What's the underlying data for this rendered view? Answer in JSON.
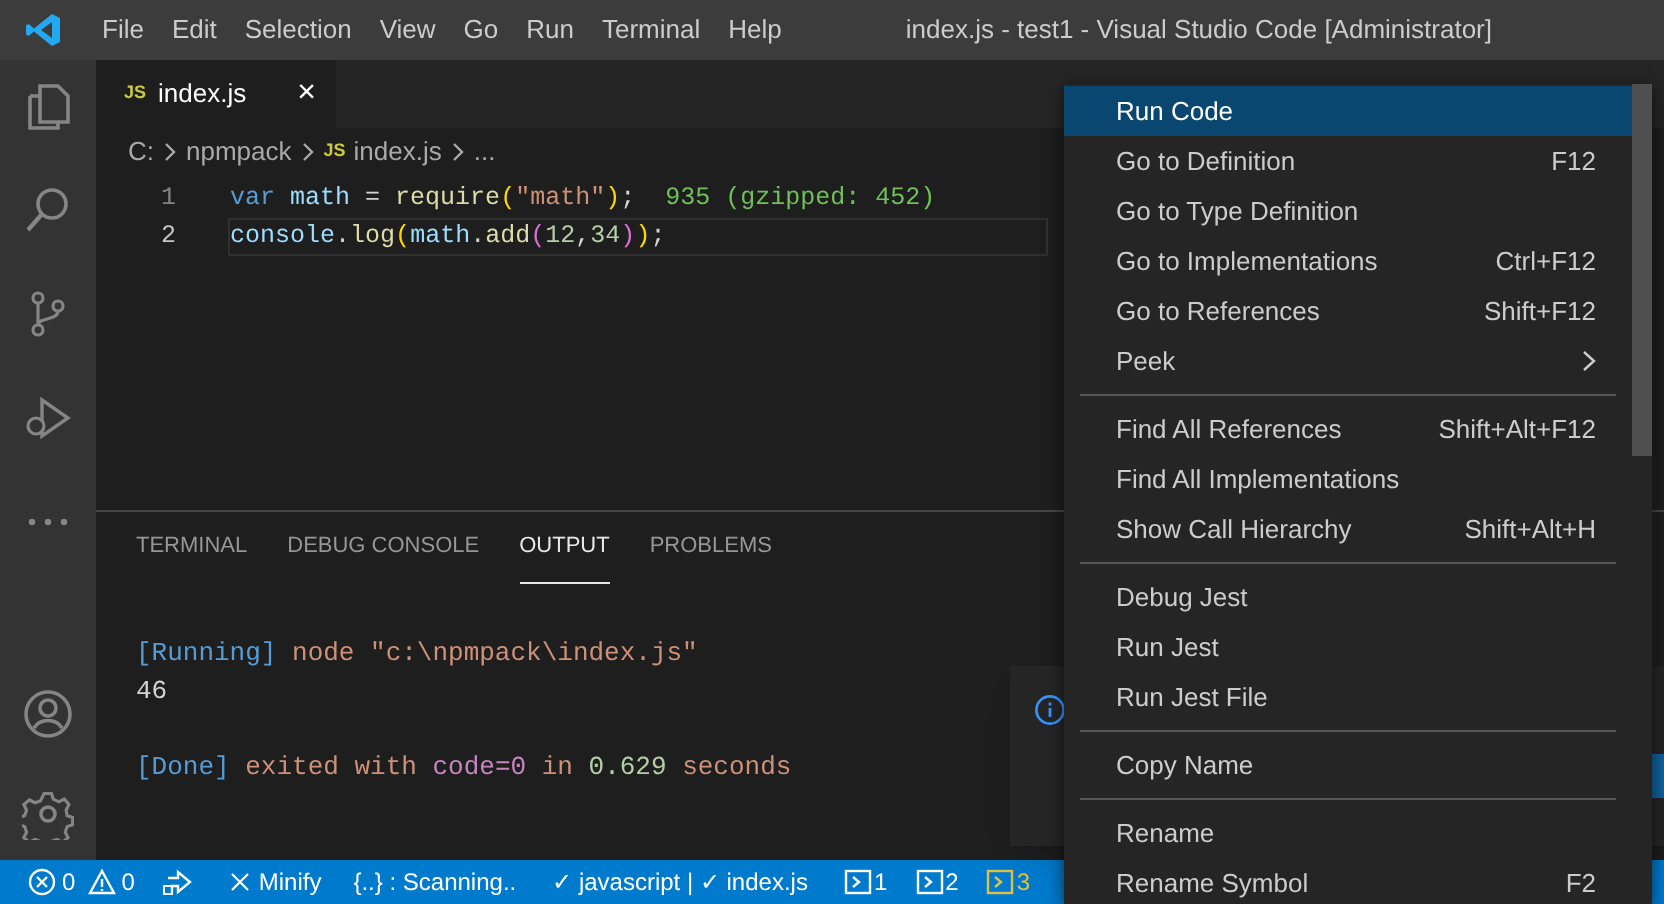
{
  "window": {
    "title": "index.js - test1 - Visual Studio Code [Administrator]"
  },
  "menu_bar": [
    "File",
    "Edit",
    "Selection",
    "View",
    "Go",
    "Run",
    "Terminal",
    "Help"
  ],
  "activity_bar": [
    {
      "kind": "files"
    },
    {
      "kind": "search"
    },
    {
      "kind": "scm"
    },
    {
      "kind": "debug"
    },
    {
      "kind": "more"
    },
    {
      "kind": "account"
    },
    {
      "kind": "settings"
    }
  ],
  "editor_tabs": [
    {
      "badge": "JS",
      "label": "index.js",
      "close": "×",
      "selected": true
    }
  ],
  "breadcrumb": [
    {
      "text": "C:"
    },
    {
      "text": "npmpack"
    },
    {
      "badge": "JS",
      "text": "index.js"
    },
    {
      "text": "..."
    }
  ],
  "code_lines": [
    {
      "number": "1",
      "current": false,
      "tokens": [
        {
          "kind": "keyword",
          "text": "var "
        },
        {
          "kind": "variable",
          "text": "math"
        },
        {
          "kind": "plain",
          "text": " = "
        },
        {
          "kind": "function",
          "text": "require"
        },
        {
          "kind": "bracket1",
          "text": "("
        },
        {
          "kind": "string",
          "text": "\"math\""
        },
        {
          "kind": "bracket1",
          "text": ")"
        },
        {
          "kind": "plain",
          "text": ";  "
        },
        {
          "kind": "hint",
          "text": "935 (gzipped: 452)"
        }
      ]
    },
    {
      "number": "2",
      "current": true,
      "tokens": [
        {
          "kind": "variable",
          "text": "console"
        },
        {
          "kind": "plain",
          "text": "."
        },
        {
          "kind": "function",
          "text": "log"
        },
        {
          "kind": "bracket1",
          "text": "("
        },
        {
          "kind": "variable",
          "text": "math"
        },
        {
          "kind": "plain",
          "text": "."
        },
        {
          "kind": "function",
          "text": "add"
        },
        {
          "kind": "bracket2",
          "text": "("
        },
        {
          "kind": "number",
          "text": "12"
        },
        {
          "kind": "plain",
          "text": ","
        },
        {
          "kind": "number",
          "text": "34"
        },
        {
          "kind": "bracket2",
          "text": ")"
        },
        {
          "kind": "bracket1",
          "text": ")"
        },
        {
          "kind": "plain",
          "text": ";"
        }
      ]
    }
  ],
  "panel_tabs": [
    {
      "label": "TERMINAL",
      "selected": false
    },
    {
      "label": "DEBUG CONSOLE",
      "selected": false
    },
    {
      "label": "OUTPUT",
      "selected": true
    },
    {
      "label": "PROBLEMS",
      "selected": false
    }
  ],
  "output_blocks": [
    [
      [
        {
          "kind": "tag",
          "text": "[Running]"
        },
        {
          "kind": "text",
          "text": " node \"c:\\npmpack\\index.js\""
        }
      ],
      [
        {
          "kind": "plain",
          "text": "46"
        }
      ]
    ],
    [
      [
        {
          "kind": "tag",
          "text": "[Done]"
        },
        {
          "kind": "text",
          "text": " exited with "
        },
        {
          "kind": "code",
          "text": "code=0"
        },
        {
          "kind": "text",
          "text": " in "
        },
        {
          "kind": "time",
          "text": "0.629"
        },
        {
          "kind": "text",
          "text": " seconds"
        }
      ]
    ]
  ],
  "context_menu": [
    {
      "kind": "item",
      "label": "Run Code",
      "selected": true
    },
    {
      "kind": "item",
      "label": "Go to Definition",
      "shortcut": "F12",
      "selected": false
    },
    {
      "kind": "item",
      "label": "Go to Type Definition",
      "selected": false
    },
    {
      "kind": "item",
      "label": "Go to Implementations",
      "shortcut": "Ctrl+F12",
      "selected": false
    },
    {
      "kind": "item",
      "label": "Go to References",
      "shortcut": "Shift+F12",
      "selected": false
    },
    {
      "kind": "submenu",
      "label": "Peek",
      "selected": false
    },
    {
      "kind": "separator"
    },
    {
      "kind": "item",
      "label": "Find All References",
      "shortcut": "Shift+Alt+F12",
      "selected": false
    },
    {
      "kind": "item",
      "label": "Find All Implementations",
      "selected": false
    },
    {
      "kind": "item",
      "label": "Show Call Hierarchy",
      "shortcut": "Shift+Alt+H",
      "selected": false
    },
    {
      "kind": "separator"
    },
    {
      "kind": "item",
      "label": "Debug Jest",
      "selected": false
    },
    {
      "kind": "item",
      "label": "Run Jest",
      "selected": false
    },
    {
      "kind": "item",
      "label": "Run Jest File",
      "selected": false
    },
    {
      "kind": "separator"
    },
    {
      "kind": "item",
      "label": "Copy Name",
      "selected": false
    },
    {
      "kind": "separator"
    },
    {
      "kind": "item",
      "label": "Rename",
      "selected": false
    },
    {
      "kind": "item",
      "label": "Rename Symbol",
      "shortcut": "F2",
      "selected": false
    }
  ],
  "status_bar": [
    {
      "kind": "errors",
      "text": "0"
    },
    {
      "kind": "warnings",
      "text": "0"
    },
    {
      "kind": "liveshare"
    },
    {
      "kind": "minify",
      "text": "Minify"
    },
    {
      "kind": "text",
      "text": "{..} : Scanning.."
    },
    {
      "kind": "text",
      "text": "✓ javascript | ✓ index.js"
    },
    {
      "kind": "terminal",
      "text": "1",
      "color": "#ffffff"
    },
    {
      "kind": "terminal",
      "text": "2",
      "color": "#ffffff"
    },
    {
      "kind": "terminal",
      "text": "3",
      "color": "#e2c044"
    }
  ]
}
